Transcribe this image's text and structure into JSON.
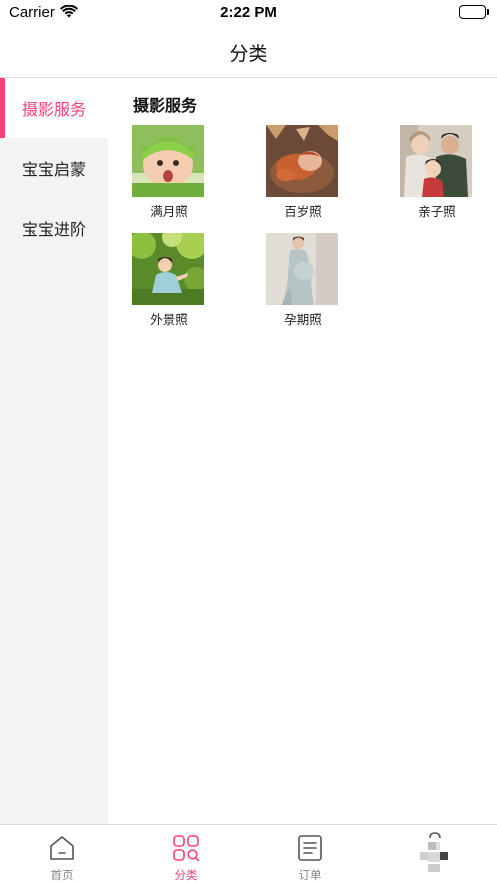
{
  "status_bar": {
    "carrier": "Carrier",
    "time": "2:22 PM"
  },
  "nav": {
    "title": "分类"
  },
  "sidebar": {
    "items": [
      {
        "label": "摄影服务",
        "active": true
      },
      {
        "label": "宝宝启蒙",
        "active": false
      },
      {
        "label": "宝宝进阶",
        "active": false
      }
    ]
  },
  "main": {
    "section_title": "摄影服务",
    "tiles": [
      {
        "label": "满月照",
        "image": "baby-in-green-knit-hat-photo"
      },
      {
        "label": "百岁照",
        "image": "sleeping-baby-on-brown-blanket-photo"
      },
      {
        "label": "亲子照",
        "image": "family-portrait-photo"
      },
      {
        "label": "外景照",
        "image": "girl-outdoors-greenery-photo"
      },
      {
        "label": "孕期照",
        "image": "maternity-portrait-photo"
      }
    ]
  },
  "tab_bar": {
    "tabs": [
      {
        "label": "首页",
        "icon": "home-icon",
        "active": false
      },
      {
        "label": "分类",
        "icon": "category-grid-icon",
        "active": true
      },
      {
        "label": "订单",
        "icon": "order-list-icon",
        "active": false
      },
      {
        "label": "",
        "icon": "profile-icon",
        "active": false
      }
    ]
  },
  "colors": {
    "accent": "#ff3f7a",
    "sidebar_bg": "#f3f3f3",
    "tab_inactive": "#888888"
  }
}
